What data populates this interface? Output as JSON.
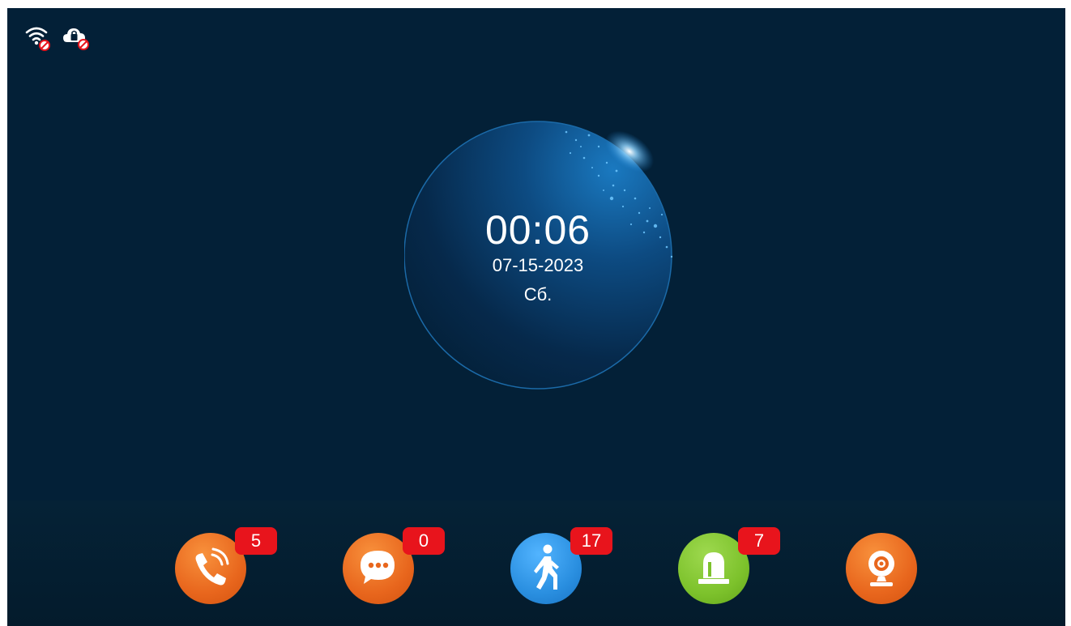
{
  "status_bar": {
    "icons": [
      "wifi-disconnected-icon",
      "cloud-lock-disconnected-icon"
    ]
  },
  "clock": {
    "time": "00:06",
    "date": "07-15-2023",
    "weekday": "Сб."
  },
  "dock": {
    "items": [
      {
        "name": "calls",
        "icon": "phone-icon",
        "badge": "5",
        "color": "#e8661d"
      },
      {
        "name": "messages",
        "icon": "chat-bubble-icon",
        "badge": "0",
        "color": "#e8661d"
      },
      {
        "name": "motion",
        "icon": "walking-person-icon",
        "badge": "17",
        "color": "#2a8fe0"
      },
      {
        "name": "alarm",
        "icon": "alarm-siren-icon",
        "badge": "7",
        "color": "#7dc22c"
      },
      {
        "name": "camera",
        "icon": "webcam-icon",
        "badge": "",
        "color": "#e8661d"
      }
    ]
  },
  "colors": {
    "background": "#032037",
    "badge": "#e8141c",
    "text": "#ffffff"
  }
}
